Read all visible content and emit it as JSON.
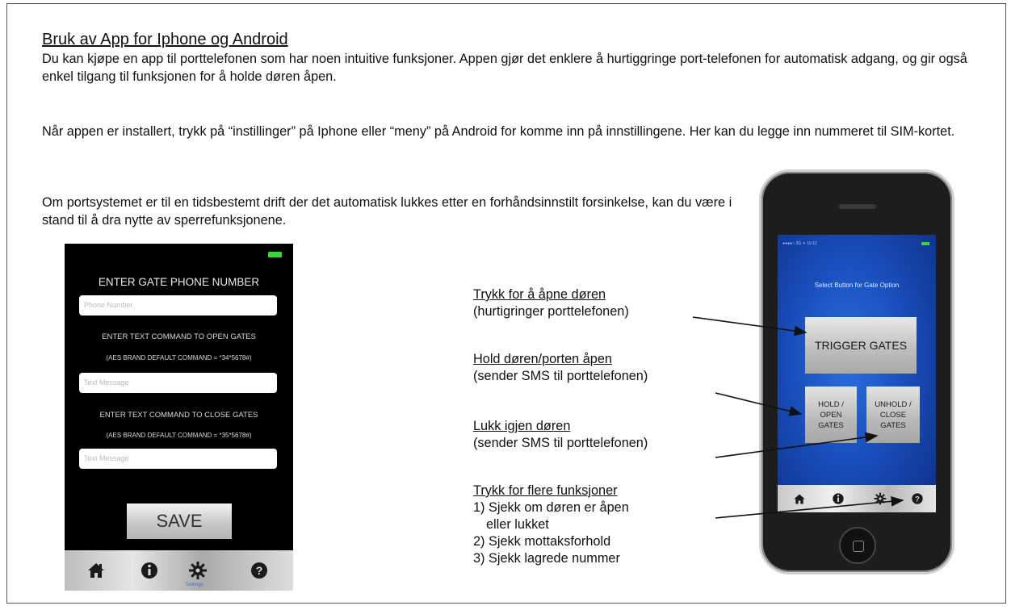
{
  "heading": "Bruk av App for Iphone og Android",
  "paragraphs": [
    "Du kan kjøpe en app til porttelefonen som har noen intuitive funksjoner. Appen gjør det enklere å hurtiggringe port-telefonen for automatisk adgang, og gir også enkel tilgang til funksjonen for å holde døren åpen.",
    "Når appen er installert, trykk på “instillinger” på Iphone eller “meny” på Android for komme inn på innstillingene. Her kan du legge inn nummeret til SIM-kortet.",
    "Om portsystemet er til en tidsbestemt drift der det automatisk lukkes etter en forhåndsinnstilt forsinkelse, kan du være i stand til å dra nytte av sperrefunksjonene."
  ],
  "app_settings": {
    "title": "ENTER GATE PHONE NUMBER",
    "phone_placeholder": "Phone Number",
    "open_label": "ENTER TEXT COMMAND TO OPEN GATES",
    "open_default": "(AES BRAND DEFAULT COMMAND = *34*5678#)",
    "open_placeholder": "Text Message",
    "close_label": "ENTER TEXT COMMAND TO CLOSE GATES",
    "close_default": "(AES BRAND DEFAULT COMMAND = *35*5678#)",
    "close_placeholder": "Text Message",
    "save_label": "SAVE",
    "settings_caption": "Settings"
  },
  "annotations": [
    {
      "title": "Trykk for å åpne døren",
      "desc": "(hurtigringer porttelefonen)"
    },
    {
      "title": "Hold døren/porten åpen",
      "desc": "(sender SMS til porttelefonen)"
    },
    {
      "title": "Lukk igjen døren",
      "desc": "(sender SMS til porttelefonen)"
    },
    {
      "title": "Trykk for flere funksjoner",
      "items": [
        "1) Sjekk om døren er åpen",
        "eller lukket",
        "2) Sjekk mottaksforhold",
        "3) Sjekk lagrede nummer"
      ]
    }
  ],
  "phone": {
    "status_text": "●●●●○ 3G  ✈  10:12",
    "select_label": "Select Button for Gate Option",
    "trigger_label": "TRIGGER GATES",
    "hold_label": "HOLD / OPEN GATES",
    "unhold_label": "UNHOLD / CLOSE GATES"
  },
  "icons": {
    "home": "home-icon",
    "info": "info-icon",
    "settings": "gear-icon",
    "help": "help-icon"
  },
  "colors": {
    "phone_screen_blue": "#1a4fbd",
    "battery_green": "#3bd23b"
  }
}
